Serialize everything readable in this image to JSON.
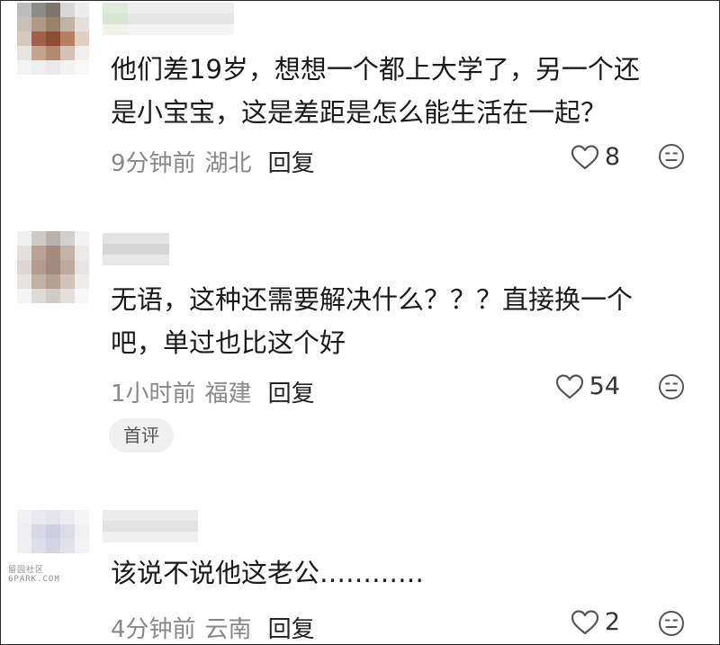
{
  "comments": [
    {
      "text_line1": "他们差19岁，想想一个都上大学了，另一个还",
      "text_line2": "是小宝宝，这是差距是怎么能生活在一起？",
      "time": "9分钟前",
      "location": "湖北",
      "reply_label": "回复",
      "likes": "8"
    },
    {
      "text_line1": "无语，这种还需要解决什么？？？直接换一个",
      "text_line2": "吧，单过也比这个好",
      "time": "1小时前",
      "location": "福建",
      "reply_label": "回复",
      "likes": "54",
      "badge": "首评"
    },
    {
      "text_line1": "该说不说他这老公…………",
      "time": "4分钟前",
      "location": "云南",
      "reply_label": "回复",
      "likes": "2"
    }
  ],
  "watermark": {
    "line1": "留园社区",
    "line2": "6PARK.COM"
  },
  "colors": {
    "text": "#1a1a1a",
    "meta": "#888888",
    "icon": "#555555"
  }
}
